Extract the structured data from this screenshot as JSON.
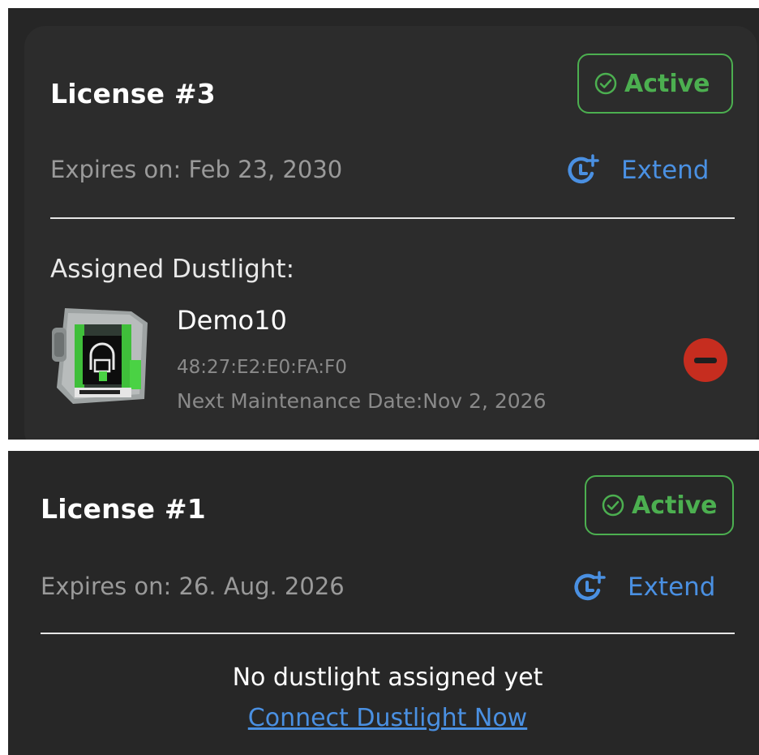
{
  "license_cards": [
    {
      "title": "License #3",
      "status": "Active",
      "expires": "Expires on: Feb 23, 2030",
      "extend_label": "Extend",
      "assigned_heading": "Assigned Dustlight:",
      "device": {
        "name": "Demo10",
        "mac": "48:27:E2:E0:FA:F0",
        "next_maintenance": "Next Maintenance Date:Nov 2, 2026"
      }
    },
    {
      "title": "License #1",
      "status": "Active",
      "expires": "Expires on: 26. Aug. 2026",
      "extend_label": "Extend",
      "empty_message": "No dustlight assigned yet",
      "connect_label": "Connect Dustlight Now"
    }
  ],
  "colors": {
    "active_green": "#4caf50",
    "link_blue": "#4a90e2",
    "remove_red": "#c62d1f",
    "card_background": "#2c2c2c"
  },
  "icons": {
    "status": "check-circle-icon",
    "extend": "clock-plus-icon",
    "remove": "minus-circle-icon",
    "device": "dustlight-device-image"
  }
}
